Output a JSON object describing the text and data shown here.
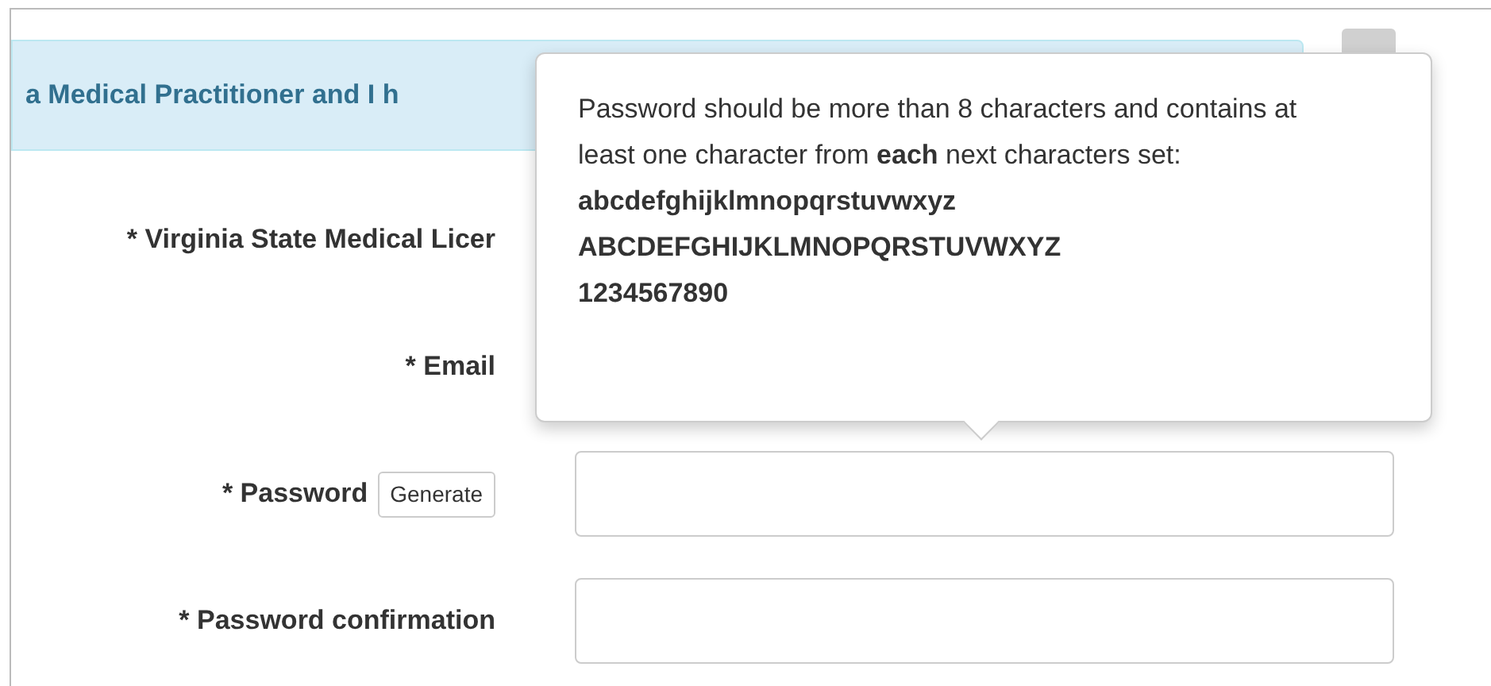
{
  "alert": {
    "text": "a Medical Practitioner and I h"
  },
  "fields": [
    {
      "label": "* Virginia State Medical Licer",
      "kind": "hidden"
    },
    {
      "label": "* Email",
      "kind": "hidden"
    },
    {
      "label": "* Password",
      "kind": "input",
      "button": "Generate"
    },
    {
      "label": "* Password confirmation",
      "kind": "input"
    }
  ],
  "tooltip": {
    "text": "Password should be more than 8 characters and contains at least one character from **each** next characters set:",
    "sets": [
      "abcdefghijklmnopqrstuvwxyz",
      "ABCDEFGHIJKLMNOPQRSTUVWXYZ",
      "1234567890"
    ]
  }
}
